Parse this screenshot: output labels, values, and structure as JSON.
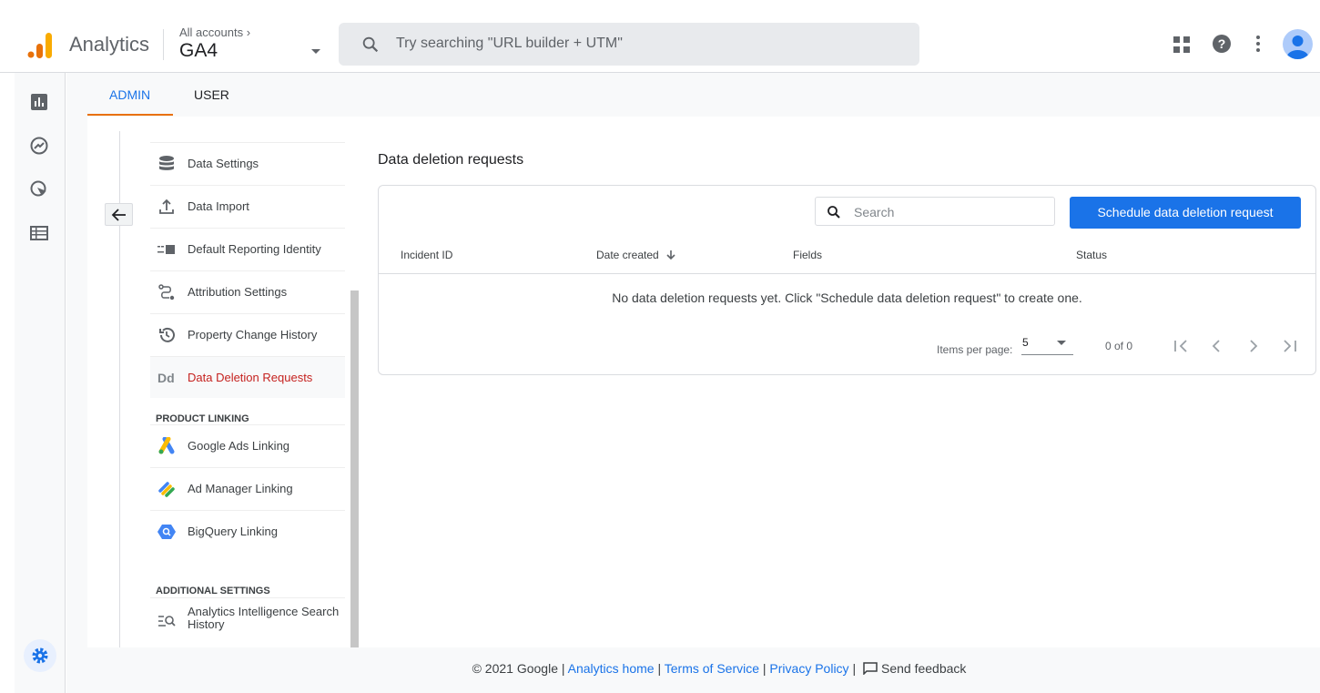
{
  "header": {
    "app_name": "Analytics",
    "account_crumb": "All accounts",
    "property": "GA4",
    "search_placeholder": "Try searching \"URL builder + UTM\""
  },
  "tabs": [
    {
      "label": "ADMIN",
      "active": true
    },
    {
      "label": "USER",
      "active": false
    }
  ],
  "nav": {
    "items": [
      {
        "label": "Data Settings",
        "icon": "database-icon"
      },
      {
        "label": "Data Import",
        "icon": "upload-icon"
      },
      {
        "label": "Default Reporting Identity",
        "icon": "identity-icon"
      },
      {
        "label": "Attribution Settings",
        "icon": "route-icon"
      },
      {
        "label": "Property Change History",
        "icon": "history-icon"
      },
      {
        "label": "Data Deletion Requests",
        "icon": "dd-icon",
        "selected": true
      }
    ],
    "product_linking_title": "PRODUCT LINKING",
    "product_linking": [
      {
        "label": "Google Ads Linking"
      },
      {
        "label": "Ad Manager Linking"
      },
      {
        "label": "BigQuery Linking"
      }
    ],
    "additional_title": "ADDITIONAL SETTINGS",
    "additional": [
      {
        "label": "Analytics Intelligence Search History"
      }
    ],
    "dd_glyph": "Dd"
  },
  "content": {
    "title": "Data deletion requests",
    "search_placeholder": "Search",
    "schedule_button": "Schedule data deletion request",
    "columns": [
      "Incident ID",
      "Date created",
      "Fields",
      "Status"
    ],
    "empty_message": "No data deletion requests yet. Click \"Schedule data deletion request\" to create one.",
    "items_per_page_label": "Items per page:",
    "items_per_page": "5",
    "range": "0 of 0"
  },
  "footer": {
    "copyright": "© 2021 Google",
    "links": [
      "Analytics home",
      "Terms of Service",
      "Privacy Policy"
    ],
    "feedback": "Send feedback",
    "sep": "|"
  },
  "colors": {
    "accent": "#1a73e8",
    "tab_indicator": "#e8710a",
    "selected_nav": "#c5221f"
  }
}
